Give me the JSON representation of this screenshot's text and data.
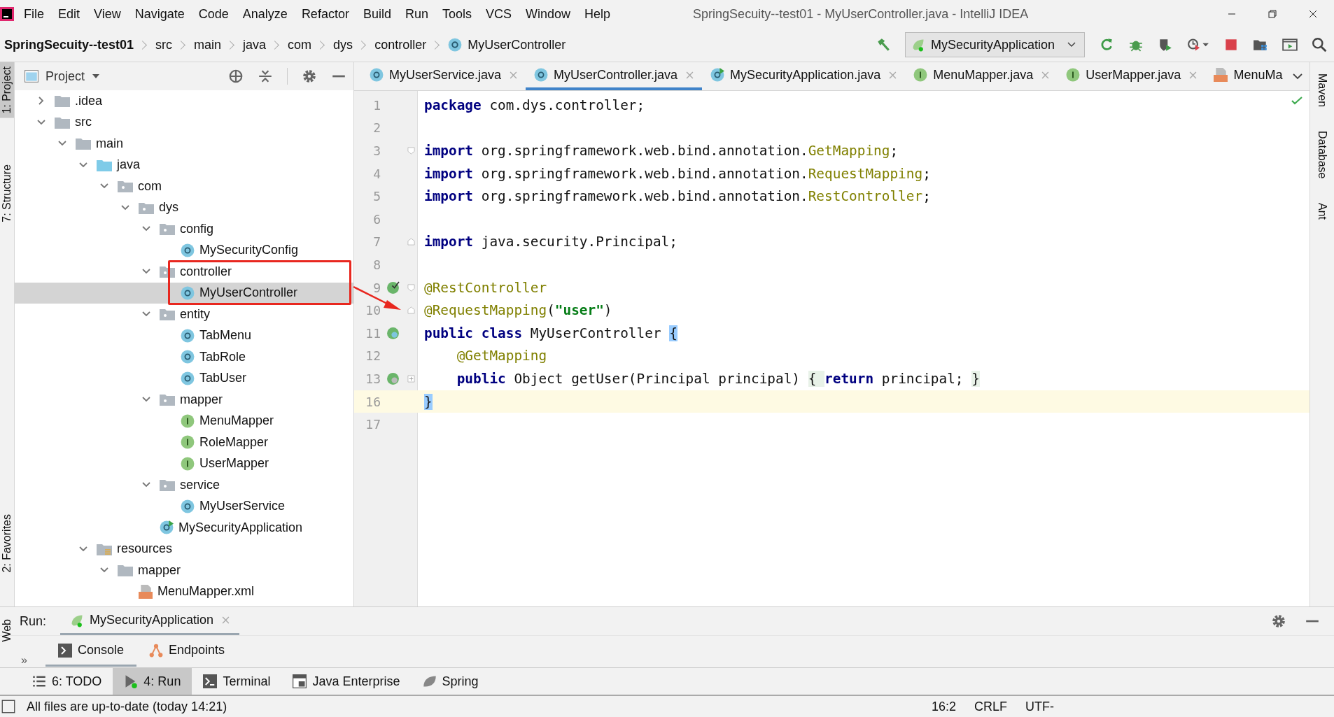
{
  "menu": [
    "File",
    "Edit",
    "View",
    "Navigate",
    "Code",
    "Analyze",
    "Refactor",
    "Build",
    "Run",
    "Tools",
    "VCS",
    "Window",
    "Help"
  ],
  "window": {
    "title": "SpringSecuity--test01 - MyUserController.java - IntelliJ IDEA"
  },
  "breadcrumbs": [
    {
      "label": "SpringSecuity--test01",
      "kind": "project"
    },
    {
      "label": "src",
      "kind": "dir"
    },
    {
      "label": "main",
      "kind": "dir"
    },
    {
      "label": "java",
      "kind": "dir"
    },
    {
      "label": "com",
      "kind": "dir"
    },
    {
      "label": "dys",
      "kind": "dir"
    },
    {
      "label": "controller",
      "kind": "dir"
    },
    {
      "label": "MyUserController",
      "kind": "class"
    }
  ],
  "run_config": {
    "label": "MySecurityApplication"
  },
  "left_strip": [
    {
      "label": "1: Project",
      "selected": true
    },
    {
      "label": "7: Structure",
      "selected": false
    },
    {
      "label": "2: Favorites",
      "selected": false
    },
    {
      "label": "Web",
      "selected": false
    }
  ],
  "right_strip": [
    "Maven",
    "Database",
    "Ant"
  ],
  "project_panel": {
    "view": "Project",
    "tree": [
      {
        "label": ".idea",
        "kind": "folder",
        "expanded": false,
        "selected": false
      },
      {
        "label": "src",
        "kind": "folder",
        "expanded": true,
        "selected": false,
        "children": [
          {
            "label": "main",
            "kind": "folder",
            "expanded": true,
            "selected": false,
            "children": [
              {
                "label": "java",
                "kind": "source",
                "expanded": true,
                "selected": false,
                "children": [
                  {
                    "label": "com",
                    "kind": "package",
                    "expanded": true,
                    "selected": false,
                    "children": [
                      {
                        "label": "dys",
                        "kind": "package",
                        "expanded": true,
                        "selected": false,
                        "children": [
                          {
                            "label": "config",
                            "kind": "package",
                            "expanded": true,
                            "selected": false,
                            "children": [
                              {
                                "label": "MySecurityConfig",
                                "kind": "class",
                                "selected": false
                              }
                            ]
                          },
                          {
                            "label": "controller",
                            "kind": "package",
                            "expanded": true,
                            "selected": false,
                            "children": [
                              {
                                "label": "MyUserController",
                                "kind": "class",
                                "selected": true
                              }
                            ]
                          },
                          {
                            "label": "entity",
                            "kind": "package",
                            "expanded": true,
                            "selected": false,
                            "children": [
                              {
                                "label": "TabMenu",
                                "kind": "class",
                                "selected": false
                              },
                              {
                                "label": "TabRole",
                                "kind": "class",
                                "selected": false
                              },
                              {
                                "label": "TabUser",
                                "kind": "class",
                                "selected": false
                              }
                            ]
                          },
                          {
                            "label": "mapper",
                            "kind": "package",
                            "expanded": true,
                            "selected": false,
                            "children": [
                              {
                                "label": "MenuMapper",
                                "kind": "interface",
                                "selected": false
                              },
                              {
                                "label": "RoleMapper",
                                "kind": "interface",
                                "selected": false
                              },
                              {
                                "label": "UserMapper",
                                "kind": "interface",
                                "selected": false
                              }
                            ]
                          },
                          {
                            "label": "service",
                            "kind": "package",
                            "expanded": true,
                            "selected": false,
                            "children": [
                              {
                                "label": "MyUserService",
                                "kind": "class",
                                "selected": false
                              }
                            ]
                          },
                          {
                            "label": "MySecurityApplication",
                            "kind": "app",
                            "selected": false
                          }
                        ]
                      }
                    ]
                  }
                ]
              },
              {
                "label": "resources",
                "kind": "resources",
                "expanded": true,
                "selected": false,
                "children": [
                  {
                    "label": "mapper",
                    "kind": "folder",
                    "expanded": true,
                    "selected": false,
                    "children": [
                      {
                        "label": "MenuMapper.xml",
                        "kind": "xml",
                        "selected": false
                      }
                    ]
                  }
                ]
              }
            ]
          }
        ]
      }
    ]
  },
  "editor": {
    "tabs": [
      {
        "label": "MyUserService.java",
        "kind": "class",
        "selected": false,
        "closable": true
      },
      {
        "label": "MyUserController.java",
        "kind": "class",
        "selected": true,
        "closable": true
      },
      {
        "label": "MySecurityApplication.java",
        "kind": "app",
        "selected": false,
        "closable": true
      },
      {
        "label": "MenuMapper.java",
        "kind": "interface",
        "selected": false,
        "closable": true
      },
      {
        "label": "UserMapper.java",
        "kind": "interface",
        "selected": false,
        "closable": true
      },
      {
        "label": "MenuMa",
        "kind": "xml",
        "selected": false,
        "closable": false
      }
    ],
    "lines": [
      {
        "number": "1",
        "current": false,
        "tokens": [
          {
            "kind": "keyword",
            "text": "package"
          },
          {
            "kind": "plain",
            "text": " com.dys.controller;"
          }
        ]
      },
      {
        "number": "2",
        "current": false
      },
      {
        "number": "3",
        "current": false,
        "fold": {
          "kind": "open"
        },
        "tokens": [
          {
            "kind": "keyword",
            "text": "import"
          },
          {
            "kind": "plain",
            "text": " org.springframework.web.bind.annotation."
          },
          {
            "kind": "annotation",
            "text": "GetMapping"
          },
          {
            "kind": "plain",
            "text": ";"
          }
        ]
      },
      {
        "number": "4",
        "current": false,
        "tokens": [
          {
            "kind": "keyword",
            "text": "import"
          },
          {
            "kind": "plain",
            "text": " org.springframework.web.bind.annotation."
          },
          {
            "kind": "annotation",
            "text": "RequestMapping"
          },
          {
            "kind": "plain",
            "text": ";"
          }
        ]
      },
      {
        "number": "5",
        "current": false,
        "tokens": [
          {
            "kind": "keyword",
            "text": "import"
          },
          {
            "kind": "plain",
            "text": " org.springframework.web.bind.annotation."
          },
          {
            "kind": "annotation",
            "text": "RestController"
          },
          {
            "kind": "plain",
            "text": ";"
          }
        ]
      },
      {
        "number": "6",
        "current": false
      },
      {
        "number": "7",
        "current": false,
        "fold": {
          "kind": "close"
        },
        "tokens": [
          {
            "kind": "keyword",
            "text": "import"
          },
          {
            "kind": "plain",
            "text": " java.security.Principal;"
          }
        ]
      },
      {
        "number": "8",
        "current": false
      },
      {
        "number": "9",
        "current": false,
        "marker": {
          "kind": "bean-check"
        },
        "fold": {
          "kind": "open"
        },
        "tokens": [
          {
            "kind": "annotation",
            "text": "@RestController"
          }
        ]
      },
      {
        "number": "10",
        "current": false,
        "fold": {
          "kind": "close"
        },
        "tokens": [
          {
            "kind": "annotation",
            "text": "@RequestMapping"
          },
          {
            "kind": "plain",
            "text": "("
          },
          {
            "kind": "string",
            "text": "\"user\""
          },
          {
            "kind": "plain",
            "text": ")"
          }
        ]
      },
      {
        "number": "11",
        "current": false,
        "marker": {
          "kind": "bean-class"
        },
        "tokens": [
          {
            "kind": "keyword",
            "text": "public class"
          },
          {
            "kind": "plain",
            "text": " MyUserController "
          },
          {
            "kind": "match",
            "text": "{"
          }
        ]
      },
      {
        "number": "12",
        "current": false,
        "tokens": [
          {
            "kind": "annotation",
            "text": "    @GetMapping"
          }
        ]
      },
      {
        "number": "13",
        "current": false,
        "marker": {
          "kind": "bean-method"
        },
        "fold": {
          "kind": "collapsed"
        },
        "tokens": [
          {
            "kind": "keyword",
            "text": "    public"
          },
          {
            "kind": "plain",
            "text": " Object getUser(Principal principal) "
          },
          {
            "kind": "folded",
            "text": "{ "
          },
          {
            "kind": "keyword",
            "text": "return"
          },
          {
            "kind": "plain",
            "text": " principal; "
          },
          {
            "kind": "folded",
            "text": "}"
          }
        ]
      },
      {
        "number": "16",
        "current": true,
        "tokens": [
          {
            "kind": "match",
            "text": "}"
          }
        ]
      },
      {
        "number": "17",
        "current": false
      }
    ]
  },
  "run_panel": {
    "label": "Run:",
    "tab": "MySecurityApplication",
    "subtabs": [
      {
        "label": "Console",
        "kind": "console",
        "selected": true
      },
      {
        "label": "Endpoints",
        "kind": "endpoints",
        "selected": false
      }
    ],
    "more": "»"
  },
  "tool_windows": [
    {
      "label": "6: TODO",
      "kind": "todo",
      "selected": false
    },
    {
      "label": "4: Run",
      "kind": "run",
      "selected": true
    },
    {
      "label": "Terminal",
      "kind": "terminal",
      "selected": false
    },
    {
      "label": "Java Enterprise",
      "kind": "enterprise",
      "selected": false
    },
    {
      "label": "Spring",
      "kind": "spring",
      "selected": false
    }
  ],
  "status_bar": {
    "message": "All files are up-to-date (today 14:21)",
    "items": [
      "16:2",
      "CRLF",
      "UTF-"
    ]
  }
}
